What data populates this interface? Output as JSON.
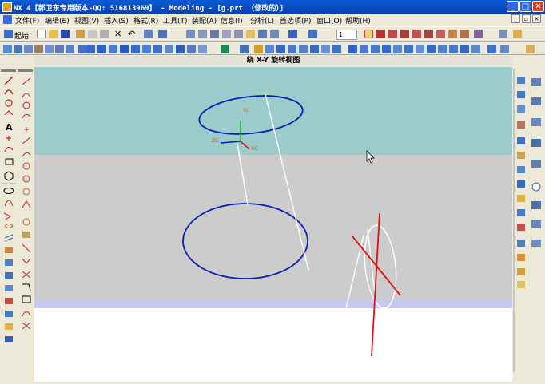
{
  "window": {
    "title": "NX 4【郭卫东专用版本-QQ: 516813969】 - Modeling - [g.prt （修改的）]",
    "minimize": "_",
    "maximize": "□",
    "close": "✕"
  },
  "menu": {
    "items": [
      "文件(F)",
      "编辑(E)",
      "视图(V)",
      "插入(S)",
      "格式(R)",
      "工具(T)",
      "装配(A)",
      "信息(I)",
      "分析(L)",
      "首选项(P)",
      "窗口(O)",
      "帮助(H)"
    ]
  },
  "toolbar": {
    "start_label": "起始",
    "layer_value": "1"
  },
  "view": {
    "title": "绕 X-Y 旋转视图",
    "wcs_labels": {
      "yc": "YC",
      "zc": "ZC",
      "xc": "XC"
    }
  },
  "colors": {
    "viewport_top": "#9bcbcb",
    "viewport_mid": "#cccccc",
    "viewport_strip": "#c8c8f4",
    "viewport_bottom": "#ffffff",
    "curve_blue": "#0a1eb4",
    "curve_white": "#ffffff",
    "curve_red": "#e01010",
    "axis_green": "#10c010",
    "axis_label": "#c06020"
  }
}
